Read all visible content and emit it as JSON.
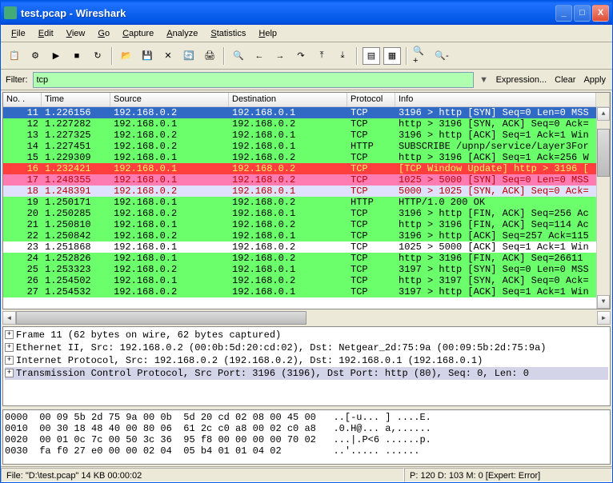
{
  "title": "test.pcap - Wireshark",
  "menus": [
    "File",
    "Edit",
    "View",
    "Go",
    "Capture",
    "Analyze",
    "Statistics",
    "Help"
  ],
  "filter": {
    "label": "Filter:",
    "value": "tcp",
    "expression": "Expression...",
    "clear": "Clear",
    "apply": "Apply"
  },
  "columns": {
    "no": "No. .",
    "time": "Time",
    "src": "Source",
    "dst": "Destination",
    "proto": "Protocol",
    "info": "Info"
  },
  "packets": [
    {
      "no": "11",
      "time": "1.226156",
      "src": "192.168.0.2",
      "dst": "192.168.0.1",
      "proto": "TCP",
      "info": "3196 > http [SYN] Seq=0 Len=0 MSS",
      "cls": "row-blue-sel"
    },
    {
      "no": "12",
      "time": "1.227282",
      "src": "192.168.0.1",
      "dst": "192.168.0.2",
      "proto": "TCP",
      "info": "http > 3196 [SYN, ACK] Seq=0 Ack=",
      "cls": "row-green"
    },
    {
      "no": "13",
      "time": "1.227325",
      "src": "192.168.0.2",
      "dst": "192.168.0.1",
      "proto": "TCP",
      "info": "3196 > http [ACK] Seq=1 Ack=1 Win",
      "cls": "row-green"
    },
    {
      "no": "14",
      "time": "1.227451",
      "src": "192.168.0.2",
      "dst": "192.168.0.1",
      "proto": "HTTP",
      "info": "SUBSCRIBE /upnp/service/Layer3For",
      "cls": "row-green"
    },
    {
      "no": "15",
      "time": "1.229309",
      "src": "192.168.0.1",
      "dst": "192.168.0.2",
      "proto": "TCP",
      "info": "http > 3196 [ACK] Seq=1 Ack=256 W",
      "cls": "row-green"
    },
    {
      "no": "16",
      "time": "1.232421",
      "src": "192.168.0.1",
      "dst": "192.168.0.2",
      "proto": "TCP",
      "info": "[TCP Window Update] http > 3196 [",
      "cls": "row-red"
    },
    {
      "no": "17",
      "time": "1.248355",
      "src": "192.168.0.1",
      "dst": "192.168.0.2",
      "proto": "TCP",
      "info": "1025 > 5000 [SYN] Seq=0 Len=0 MSS",
      "cls": "row-pink row-red-text"
    },
    {
      "no": "18",
      "time": "1.248391",
      "src": "192.168.0.2",
      "dst": "192.168.0.1",
      "proto": "TCP",
      "info": "5000 > 1025 [SYN, ACK] Seq=0 Ack=",
      "cls": "row-lavender row-red-text"
    },
    {
      "no": "19",
      "time": "1.250171",
      "src": "192.168.0.1",
      "dst": "192.168.0.2",
      "proto": "HTTP",
      "info": "HTTP/1.0 200 OK",
      "cls": "row-green"
    },
    {
      "no": "20",
      "time": "1.250285",
      "src": "192.168.0.2",
      "dst": "192.168.0.1",
      "proto": "TCP",
      "info": "3196 > http [FIN, ACK] Seq=256 Ac",
      "cls": "row-green"
    },
    {
      "no": "21",
      "time": "1.250810",
      "src": "192.168.0.1",
      "dst": "192.168.0.2",
      "proto": "TCP",
      "info": "http > 3196 [FIN, ACK] Seq=114 Ac",
      "cls": "row-green"
    },
    {
      "no": "22",
      "time": "1.250842",
      "src": "192.168.0.2",
      "dst": "192.168.0.1",
      "proto": "TCP",
      "info": "3196 > http [ACK] Seq=257 Ack=115",
      "cls": "row-green"
    },
    {
      "no": "23",
      "time": "1.251868",
      "src": "192.168.0.1",
      "dst": "192.168.0.2",
      "proto": "TCP",
      "info": "1025 > 5000 [ACK] Seq=1 Ack=1 Win",
      "cls": "row-normal"
    },
    {
      "no": "24",
      "time": "1.252826",
      "src": "192.168.0.1",
      "dst": "192.168.0.2",
      "proto": "TCP",
      "info": "http > 3196 [FIN, ACK] Seq=26611 ",
      "cls": "row-green"
    },
    {
      "no": "25",
      "time": "1.253323",
      "src": "192.168.0.2",
      "dst": "192.168.0.1",
      "proto": "TCP",
      "info": "3197 > http [SYN] Seq=0 Len=0 MSS",
      "cls": "row-green"
    },
    {
      "no": "26",
      "time": "1.254502",
      "src": "192.168.0.1",
      "dst": "192.168.0.2",
      "proto": "TCP",
      "info": "http > 3197 [SYN, ACK] Seq=0 Ack=",
      "cls": "row-green"
    },
    {
      "no": "27",
      "time": "1.254532",
      "src": "192.168.0.2",
      "dst": "192.168.0.1",
      "proto": "TCP",
      "info": "3197 > http [ACK] Seq=1 Ack=1 Win",
      "cls": "row-green"
    }
  ],
  "details": [
    "Frame 11 (62 bytes on wire, 62 bytes captured)",
    "Ethernet II, Src: 192.168.0.2 (00:0b:5d:20:cd:02), Dst: Netgear_2d:75:9a (00:09:5b:2d:75:9a)",
    "Internet Protocol, Src: 192.168.0.2 (192.168.0.2), Dst: 192.168.0.1 (192.168.0.1)",
    "Transmission Control Protocol, Src Port: 3196 (3196), Dst Port: http (80), Seq: 0, Len: 0"
  ],
  "hex": "0000  00 09 5b 2d 75 9a 00 0b  5d 20 cd 02 08 00 45 00   ..[-u... ] ....E.\n0010  00 30 18 48 40 00 80 06  61 2c c0 a8 00 02 c0 a8   .0.H@... a,......\n0020  00 01 0c 7c 00 50 3c 36  95 f8 00 00 00 00 70 02   ...|.P<6 ......p.\n0030  fa f0 27 e0 00 00 02 04  05 b4 01 01 04 02         ..'..... ......",
  "status": {
    "left": "File: \"D:\\test.pcap\" 14 KB 00:00:02",
    "right": "P: 120 D: 103 M: 0 [Expert: Error]"
  }
}
